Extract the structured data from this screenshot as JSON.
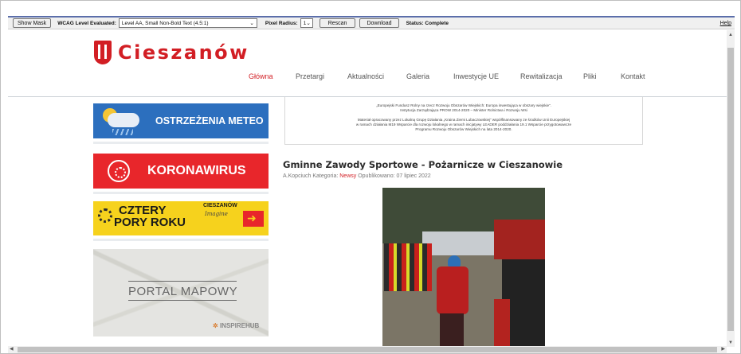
{
  "toolbar": {
    "show_mask": "Show Mask",
    "wcag_label": "WCAG Level Evaluated:",
    "wcag_value": "Level AA, Small Non-Bold Text (4.5:1)",
    "pixel_radius_label": "Pixel Radius:",
    "pixel_radius_value": "1",
    "rescan": "Rescan",
    "download": "Download",
    "status": "Status: Complete",
    "help": "Help"
  },
  "site": {
    "logo_text": "Cieszanów",
    "brand_color": "#d21e24"
  },
  "nav": {
    "items": [
      {
        "label": "Główna",
        "active": true
      },
      {
        "label": "Przetargi"
      },
      {
        "label": "Aktualności"
      },
      {
        "label": "Galeria"
      },
      {
        "label": "Inwestycje UE"
      },
      {
        "label": "Rewitalizacja"
      },
      {
        "label": "Pliki"
      },
      {
        "label": "Kontakt"
      }
    ]
  },
  "sidebar": {
    "meteo": "OSTRZEŻENIA METEO",
    "korona": "KORONAWIRUS",
    "pory_line1": "CZTERY",
    "pory_line2": "PORY ROKU",
    "pory_brand": "CIESZANÓW",
    "pory_tag": "Imagine",
    "portal": "PORTAL MAPOWY",
    "inspire": "INSPIREHUB"
  },
  "funds": {
    "line1": "„Europejski Fundusz Rolny na rzecz Rozwoju Obszarów Wiejskich: Europa inwestująca w obszary wiejskie”.",
    "line2": "Instytucja Zarządzająca PROW 2014-2020 – Minister Rolnictwa i Rozwoju Wsi",
    "line3": "Materiał opracowany przez Lokalną Grupę Działania „Kraina Ziemi Lubaczowskiej” współfinansowany ze środków Unii Europejskiej",
    "line4": "w ramach działania M19 Wsparcie dla rozwoju lokalnego w ramach inicjatywy LEADER poddziałania 19.1 Wsparcie przygotowawcze",
    "line5": "Programu Rozwoju Obszarów Wiejskich na lata 2014-2020."
  },
  "article": {
    "title": "Gminne Zawody Sportowe - Pożarnicze w Cieszanowie",
    "author": "A.Kopciuch",
    "category_label": "Kategoria:",
    "category": "Newsy",
    "published": "Opublikowano: 07 lipiec 2022"
  }
}
